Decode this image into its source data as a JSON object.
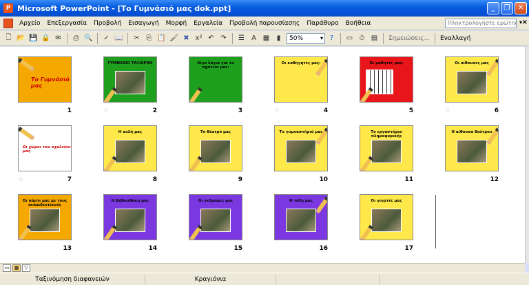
{
  "window": {
    "title": "Microsoft PowerPoint - [Το Γυμνάσιό μας dok.ppt]",
    "app_icon": "powerpoint-icon"
  },
  "menu": {
    "items": [
      "Αρχείο",
      "Επεξεργασία",
      "Προβολή",
      "Εισαγωγή",
      "Μορφή",
      "Εργαλεία",
      "Προβολή παρουσίασης",
      "Παράθυρο",
      "Βοήθεια"
    ],
    "help_placeholder": "Πληκτρολογήστε ερώτηση"
  },
  "toolbar": {
    "zoom": "50%",
    "comments_label": "Σημειώσεις...",
    "change_label": "Εναλλαγή"
  },
  "slides": [
    {
      "num": "1",
      "bg": "#f5a800",
      "title": "Το Γυμνάσιό μας",
      "star": false
    },
    {
      "num": "2",
      "bg": "#1ea01e",
      "title": "ΓΥΜΝΑΣΙΟ ΤΑΞΙΑΡΧΗ",
      "star": true
    },
    {
      "num": "3",
      "bg": "#1ea01e",
      "title": "Λίγα λόγια για το σχολείο μας:",
      "star": false
    },
    {
      "num": "4",
      "bg": "#ffe94a",
      "title": "Οι καθηγητές μας:",
      "star": true
    },
    {
      "num": "5",
      "bg": "#e8161a",
      "title": "Οι μαθητές μας:",
      "star": false
    },
    {
      "num": "6",
      "bg": "#ffe94a",
      "title": "Οι αίθουσες μας",
      "star": true
    },
    {
      "num": "7",
      "bg": "#ffffff",
      "title": "Οι χώροι του σχολείου μας",
      "star": true
    },
    {
      "num": "8",
      "bg": "#ffe94a",
      "title": "Η αυλή μας",
      "star": false
    },
    {
      "num": "9",
      "bg": "#ffe94a",
      "title": "Το θέατρό μας",
      "star": false
    },
    {
      "num": "10",
      "bg": "#ffe94a",
      "title": "Το γυμναστήριό μας",
      "star": false
    },
    {
      "num": "11",
      "bg": "#ffe94a",
      "title": "Το εργαστήριο πληροφορικής",
      "star": false
    },
    {
      "num": "12",
      "bg": "#ffe94a",
      "title": "Η αίθουσα θεάτρου",
      "star": false
    },
    {
      "num": "13",
      "bg": "#f5a800",
      "title": "Οι πάρτι μας με τους εκπαιδευτικούς",
      "star": false
    },
    {
      "num": "14",
      "bg": "#7b38e0",
      "title": "Η βιβλιοθήκη μας",
      "star": false
    },
    {
      "num": "15",
      "bg": "#7b38e0",
      "title": "Οι εκδρομές μας",
      "star": false
    },
    {
      "num": "16",
      "bg": "#7b38e0",
      "title": "Η τάξη μας",
      "star": false
    },
    {
      "num": "17",
      "bg": "#ffe94a",
      "title": "Οι γιορτές μας",
      "star": false
    }
  ],
  "status": {
    "view": "Ταξινόμηση διαφανειών",
    "theme": "Κραγιόνια"
  }
}
